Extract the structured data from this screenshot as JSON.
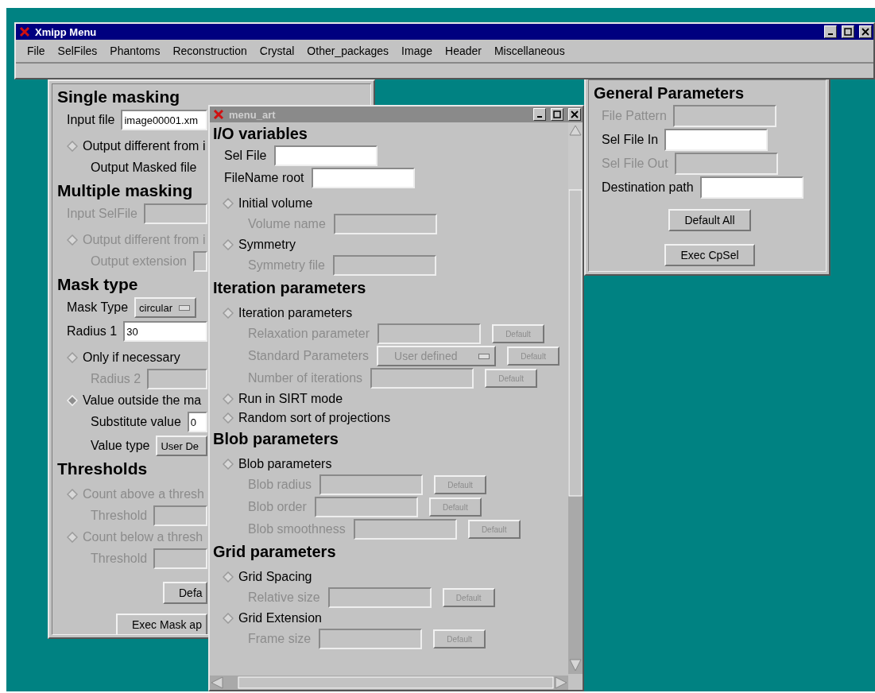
{
  "menu_window": {
    "title": "Xmipp Menu",
    "active": true,
    "menu": [
      "File",
      "SelFiles",
      "Phantoms",
      "Reconstruction",
      "Crystal",
      "Other_packages",
      "Image",
      "Header",
      "Miscellaneous"
    ]
  },
  "mask_window": {
    "sections": [
      {
        "heading": "Single masking",
        "items": [
          {
            "kind": "field",
            "label": "Input file",
            "value": "image00001.xm",
            "disabled": false
          },
          {
            "kind": "radio",
            "label": "Output different from i",
            "selected": false,
            "disabled": false,
            "children": [
              {
                "kind": "text",
                "label": "Output Masked file",
                "disabled": false
              }
            ]
          }
        ]
      },
      {
        "heading": "Multiple masking",
        "items": [
          {
            "kind": "field",
            "label": "Input SelFile",
            "disabled": true
          },
          {
            "kind": "radio",
            "label": "Output different from i",
            "selected": false,
            "disabled": true,
            "children": [
              {
                "kind": "field",
                "label": "Output extension",
                "disabled": true
              }
            ]
          }
        ]
      },
      {
        "heading": "Mask type",
        "items": [
          {
            "kind": "select",
            "label": "Mask Type",
            "value": "circular",
            "disabled": false
          },
          {
            "kind": "field",
            "label": "Radius 1",
            "value": "30",
            "disabled": false
          },
          {
            "kind": "radio",
            "label": "Only if necessary",
            "selected": false,
            "disabled": false,
            "children": [
              {
                "kind": "field",
                "label": "Radius 2",
                "disabled": true
              }
            ]
          },
          {
            "kind": "radio",
            "label": "Value outside the ma",
            "selected": true,
            "disabled": false,
            "children": [
              {
                "kind": "field",
                "label": "Substitute value",
                "value": "0",
                "disabled": false
              },
              {
                "kind": "select",
                "label": "Value type",
                "value": "User De",
                "disabled": false
              }
            ]
          }
        ]
      },
      {
        "heading": "Thresholds",
        "items": [
          {
            "kind": "radio",
            "label": "Count above a thresh",
            "selected": false,
            "disabled": true,
            "children": [
              {
                "kind": "field",
                "label": "Threshold",
                "disabled": true
              }
            ]
          },
          {
            "kind": "radio",
            "label": "Count below a thresh",
            "selected": false,
            "disabled": true,
            "children": [
              {
                "kind": "field",
                "label": "Threshold",
                "disabled": true
              }
            ]
          }
        ]
      }
    ],
    "buttons": [
      "Defa",
      "Exec Mask ap"
    ]
  },
  "cpsel_window": {
    "sections": [
      {
        "heading": "General Parameters",
        "items": [
          {
            "kind": "field",
            "label": "File Pattern",
            "disabled": true
          },
          {
            "kind": "field",
            "label": "Sel File In",
            "disabled": false
          },
          {
            "kind": "field",
            "label": "Sel File Out",
            "disabled": true
          },
          {
            "kind": "field",
            "label": "Destination path",
            "disabled": false
          }
        ]
      }
    ],
    "buttons": [
      "Default All",
      "Exec CpSel"
    ]
  },
  "art_window": {
    "title": "menu_art",
    "active": false,
    "sections": [
      {
        "heading": "I/O variables",
        "items": [
          {
            "kind": "field",
            "label": "Sel File",
            "disabled": false
          },
          {
            "kind": "field",
            "label": "FileName root",
            "disabled": false
          },
          {
            "kind": "radio",
            "label": "Initial volume",
            "selected": false,
            "disabled": false,
            "children": [
              {
                "kind": "field",
                "label": "Volume name",
                "disabled": true
              }
            ]
          },
          {
            "kind": "radio",
            "label": "Symmetry",
            "selected": false,
            "disabled": false,
            "children": [
              {
                "kind": "field",
                "label": "Symmetry file",
                "disabled": true
              }
            ]
          }
        ]
      },
      {
        "heading": "Iteration parameters",
        "items": [
          {
            "kind": "radio",
            "label": "Iteration parameters",
            "selected": false,
            "disabled": false,
            "children": [
              {
                "kind": "field",
                "label": "Relaxation parameter",
                "disabled": true,
                "default_button": "Default"
              },
              {
                "kind": "select",
                "label": "Standard Parameters",
                "value": "User defined",
                "disabled": true,
                "default_button": "Default"
              },
              {
                "kind": "field",
                "label": "Number of iterations",
                "disabled": true,
                "default_button": "Default"
              }
            ]
          },
          {
            "kind": "radio",
            "label": "Run in SIRT mode",
            "selected": false,
            "disabled": false
          },
          {
            "kind": "radio",
            "label": "Random sort of projections",
            "selected": false,
            "disabled": false
          }
        ]
      },
      {
        "heading": "Blob parameters",
        "items": [
          {
            "kind": "radio",
            "label": "Blob parameters",
            "selected": false,
            "disabled": false,
            "children": [
              {
                "kind": "field",
                "label": "Blob radius",
                "disabled": true,
                "default_button": "Default"
              },
              {
                "kind": "field",
                "label": "Blob order",
                "disabled": true,
                "default_button": "Default"
              },
              {
                "kind": "field",
                "label": "Blob smoothness",
                "disabled": true,
                "default_button": "Default"
              }
            ]
          }
        ]
      },
      {
        "heading": "Grid parameters",
        "items": [
          {
            "kind": "radio",
            "label": "Grid Spacing",
            "selected": false,
            "disabled": false,
            "children": [
              {
                "kind": "field",
                "label": "Relative size",
                "disabled": true,
                "default_button": "Default"
              }
            ]
          },
          {
            "kind": "radio",
            "label": "Grid Extension",
            "selected": false,
            "disabled": false,
            "children": [
              {
                "kind": "field",
                "label": "Frame size",
                "disabled": true,
                "default_button": "Default"
              }
            ]
          }
        ]
      }
    ]
  }
}
